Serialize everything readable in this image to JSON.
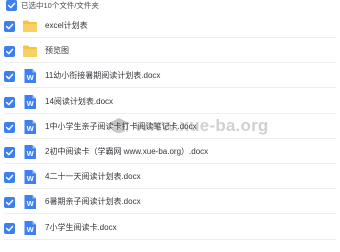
{
  "header": {
    "selection_text": "已选中10个文件/文件夹"
  },
  "files": [
    {
      "name": "excel计划表",
      "type": "folder"
    },
    {
      "name": "预览图",
      "type": "folder"
    },
    {
      "name": "11幼小衔接暑期阅读计划表.docx",
      "type": "word"
    },
    {
      "name": "14阅读计划表.docx",
      "type": "word"
    },
    {
      "name": "1中小学生亲子阅读卡打卡阅读笔记卡.docx",
      "type": "word"
    },
    {
      "name": "2初中阅读卡（学霸网 www.xue-ba.org）.docx",
      "type": "word"
    },
    {
      "name": "4二十一天阅读计划表.docx",
      "type": "word"
    },
    {
      "name": "6暑期亲子阅读计划表.docx",
      "type": "word"
    },
    {
      "name": "7小学生阅读卡.docx",
      "type": "word"
    }
  ],
  "watermark": {
    "text": "www.xue-ba.org"
  },
  "colors": {
    "checkbox_blue": "#3b7ff1",
    "folder_yellow": "#f5c342",
    "word_blue": "#3e7ff2"
  }
}
